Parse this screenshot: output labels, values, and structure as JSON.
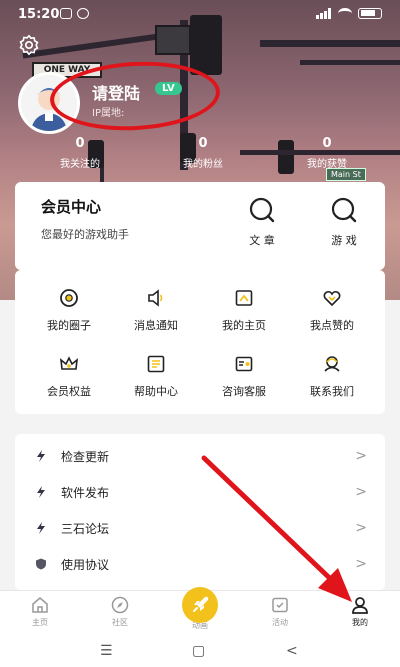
{
  "status_bar": {
    "time": "15:20"
  },
  "profile": {
    "login_text": "请登陆",
    "level_badge": "LV",
    "ip_label": "IP属地:"
  },
  "stats": [
    {
      "value": "0",
      "label": "我关注的"
    },
    {
      "value": "0",
      "label": "我的粉丝"
    },
    {
      "value": "0",
      "label": "我的获赞"
    }
  ],
  "member": {
    "title": "会员中心",
    "subtitle": "您最好的游戏助手",
    "quick_links": [
      {
        "label": "文 章",
        "icon": "search-icon"
      },
      {
        "label": "游 戏",
        "icon": "search-icon"
      }
    ]
  },
  "grid": [
    {
      "label": "我的圈子",
      "icon": "circle-icon"
    },
    {
      "label": "消息通知",
      "icon": "speaker-icon"
    },
    {
      "label": "我的主页",
      "icon": "homepage-icon"
    },
    {
      "label": "我点赞的",
      "icon": "heart-icon"
    },
    {
      "label": "会员权益",
      "icon": "crown-icon"
    },
    {
      "label": "帮助中心",
      "icon": "help-icon"
    },
    {
      "label": "咨询客服",
      "icon": "service-icon"
    },
    {
      "label": "联系我们",
      "icon": "contact-icon"
    }
  ],
  "list": [
    {
      "label": "检查更新",
      "icon": "lightning-icon"
    },
    {
      "label": "软件发布",
      "icon": "lightning-icon"
    },
    {
      "label": "三石论坛",
      "icon": "lightning-icon"
    },
    {
      "label": "使用协议",
      "icon": "shield-icon"
    }
  ],
  "bottom_nav": [
    {
      "label": "主页",
      "icon": "home-icon"
    },
    {
      "label": "社区",
      "icon": "compass-icon"
    },
    {
      "label": "动画",
      "icon": "rocket-icon"
    },
    {
      "label": "活动",
      "icon": "activity-icon"
    },
    {
      "label": "我的",
      "icon": "user-icon",
      "active": true
    }
  ],
  "colors": {
    "accent_yellow": "#f2c11c",
    "badge_green": "#35c78f",
    "annotation_red": "#e0151b"
  },
  "hero_signs": {
    "one_way": "ONE WAY",
    "street": "Main St"
  }
}
